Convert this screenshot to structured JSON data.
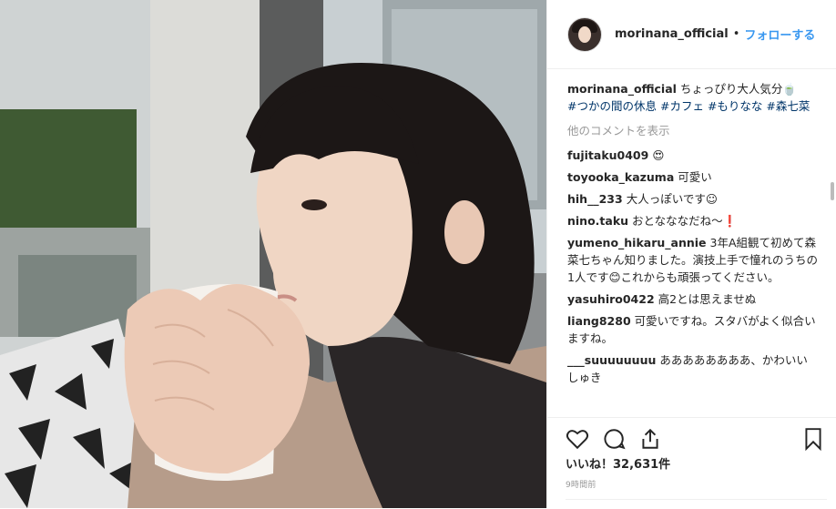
{
  "post": {
    "username": "morinana_official",
    "dot": "•",
    "follow": "フォローする",
    "caption_text": "ちょっぴり大人気分🍵",
    "hashtags": [
      "#つかの間の休息",
      "#カフェ",
      "#もりなな",
      "#森七菜"
    ],
    "view_more": "他のコメントを表示",
    "comments": [
      {
        "user": "fujitaku0409",
        "text": "😍"
      },
      {
        "user": "toyooka_kazuma",
        "text": "可愛い"
      },
      {
        "user": "hih__233",
        "text": "大人っぽいです☺"
      },
      {
        "user": "nino.taku",
        "text": "おとなななだね〜❗"
      },
      {
        "user": "yumeno_hikaru_annie",
        "text": "3年A組観て初めて森菜七ちゃん知りました。演技上手で憧れのうちの1人です😊これからも頑張ってください。"
      },
      {
        "user": "yasuhiro0422",
        "text": "高2とは思えませぬ"
      },
      {
        "user": "liang8280",
        "text": "可愛いですね。スタバがよく似合いますね。"
      },
      {
        "user": "___suuuuuuuu",
        "text": "ああああああああ、かわいいしゅき"
      }
    ],
    "likes": "いいね！32,631件",
    "time": "9時間前"
  },
  "icons": [
    "heart-icon",
    "comment-icon",
    "share-icon",
    "bookmark-icon"
  ],
  "colors": {
    "link": "#3897f0",
    "hashtag": "#003569",
    "muted": "#999999"
  }
}
